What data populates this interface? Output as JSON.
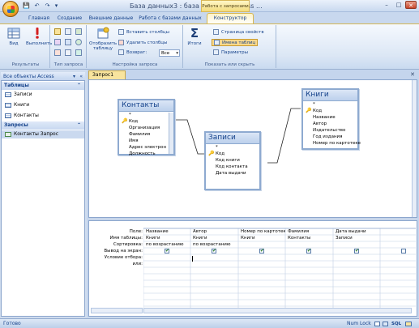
{
  "window": {
    "title": "База данных3 : база данных (Access ...",
    "context_tab_group": "Работа с запросами",
    "minimize": "–",
    "maximize": "□",
    "close": "✕"
  },
  "quick_access": {
    "save": "💾",
    "undo": "↶",
    "redo": "↷",
    "more": "▾"
  },
  "ribbon": {
    "tabs": [
      {
        "label": "Главная"
      },
      {
        "label": "Создание"
      },
      {
        "label": "Внешние данные"
      },
      {
        "label": "Работа с базами данных"
      },
      {
        "label": "Конструктор"
      }
    ],
    "groups": {
      "results": {
        "label": "Результаты",
        "view": "Вид",
        "run": "Выполнить"
      },
      "query_type": {
        "label": "Тип запроса"
      },
      "query_setup": {
        "label": "Настройка запроса",
        "show_table": "Отобразить таблицу",
        "insert_columns": "Вставить столбцы",
        "delete_columns": "Удалить столбцы",
        "return": "Возврат:",
        "return_value": "Все"
      },
      "show_hide": {
        "label": "Показать или скрыть",
        "totals": "Итоги",
        "property_sheet": "Страница свойств",
        "table_names": "Имена таблиц",
        "parameters": "Параметры"
      }
    }
  },
  "nav": {
    "header": "Все объекты Access",
    "sections": [
      {
        "title": "Таблицы",
        "items": [
          {
            "label": "Записи"
          },
          {
            "label": "Книги"
          },
          {
            "label": "Контакты"
          }
        ]
      },
      {
        "title": "Запросы",
        "items": [
          {
            "label": "Контакты Запрос"
          }
        ]
      }
    ]
  },
  "document": {
    "tab": "Запрос1",
    "tables": [
      {
        "name": "Контакты",
        "fields": [
          "*",
          "Код",
          "Организация",
          "Фамилия",
          "Имя",
          "Адрес электрон",
          "Должность"
        ]
      },
      {
        "name": "Записи",
        "fields": [
          "*",
          "Код",
          "Код книги",
          "Код контакта",
          "Дата выдачи"
        ]
      },
      {
        "name": "Книги",
        "fields": [
          "*",
          "Код",
          "Название",
          "Автор",
          "Издательство",
          "Год издания",
          "Номер по картотеке"
        ]
      }
    ]
  },
  "grid": {
    "row_labels": [
      "Поле:",
      "Имя таблицы:",
      "Сортировка:",
      "Вывод на экран:",
      "Условие отбора:",
      "или:"
    ],
    "columns": [
      {
        "field": "Название",
        "table": "Книги",
        "sort": "по возрастанию",
        "show": true
      },
      {
        "field": "Автор",
        "table": "Книги",
        "sort": "по возрастанию",
        "show": true
      },
      {
        "field": "Номер по картотеке",
        "table": "Книги",
        "sort": "",
        "show": true
      },
      {
        "field": "Фамилия",
        "table": "Контакты",
        "sort": "",
        "show": true
      },
      {
        "field": "Дата выдачи",
        "table": "Записи",
        "sort": "",
        "show": true
      },
      {
        "field": "",
        "table": "",
        "sort": "",
        "show": false
      }
    ]
  },
  "status": {
    "left": "Готово",
    "num_lock": "Num Lock",
    "sql": "SQL"
  },
  "colors": {
    "accent": "#15428b",
    "ribbon": "#dce7f5",
    "active_tab": "#f8e49e"
  }
}
